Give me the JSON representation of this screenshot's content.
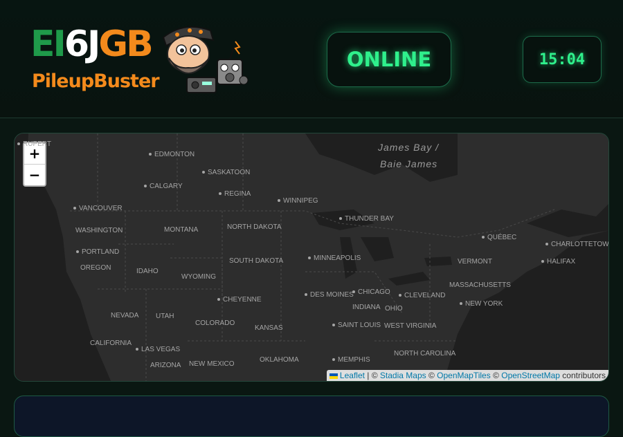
{
  "logo": {
    "callsign_part1": "EI",
    "callsign_part2": "6J",
    "callsign_part3": "GB",
    "tagline": "PileupBuster"
  },
  "status": {
    "text": "ONLINE",
    "color": "#2ff08c"
  },
  "clock": {
    "time": "15:04"
  },
  "map": {
    "zoom_in": "+",
    "zoom_out": "−",
    "water_labels": [
      "James Bay /",
      "Baie James"
    ],
    "cities": [
      "RUPERT",
      "EDMONTON",
      "SASKATOON",
      "CALGARY",
      "REGINA",
      "WINNIPEG",
      "VANCOUVER",
      "THUNDER BAY",
      "PORTLAND",
      "MINNEAPOLIS",
      "CHEYENNE",
      "DES MOINES",
      "CHICAGO",
      "CLEVELAND",
      "SAINT LOUIS",
      "LAS VEGAS",
      "MEMPHIS",
      "NEW YORK",
      "QUÉBEC",
      "CHARLOTTETOWN",
      "HALIFAX"
    ],
    "regions": [
      "WASHINGTON",
      "MONTANA",
      "NORTH DAKOTA",
      "SOUTH DAKOTA",
      "OREGON",
      "IDAHO",
      "WYOMING",
      "NEVADA",
      "UTAH",
      "COLORADO",
      "KANSAS",
      "CALIFORNIA",
      "ARIZONA",
      "NEW MEXICO",
      "OKLAHOMA",
      "INDIANA",
      "OHIO",
      "WEST VIRGINIA",
      "NORTH CAROLINA",
      "VERMONT",
      "MASSACHUSETTS"
    ],
    "attribution": {
      "leaflet": "Leaflet",
      "sep1": " | © ",
      "stadia": "Stadia Maps",
      "sep2": " © ",
      "omt": "OpenMapTiles",
      "sep3": " © ",
      "osm": "OpenStreetMap",
      "tail": " contributors"
    }
  }
}
